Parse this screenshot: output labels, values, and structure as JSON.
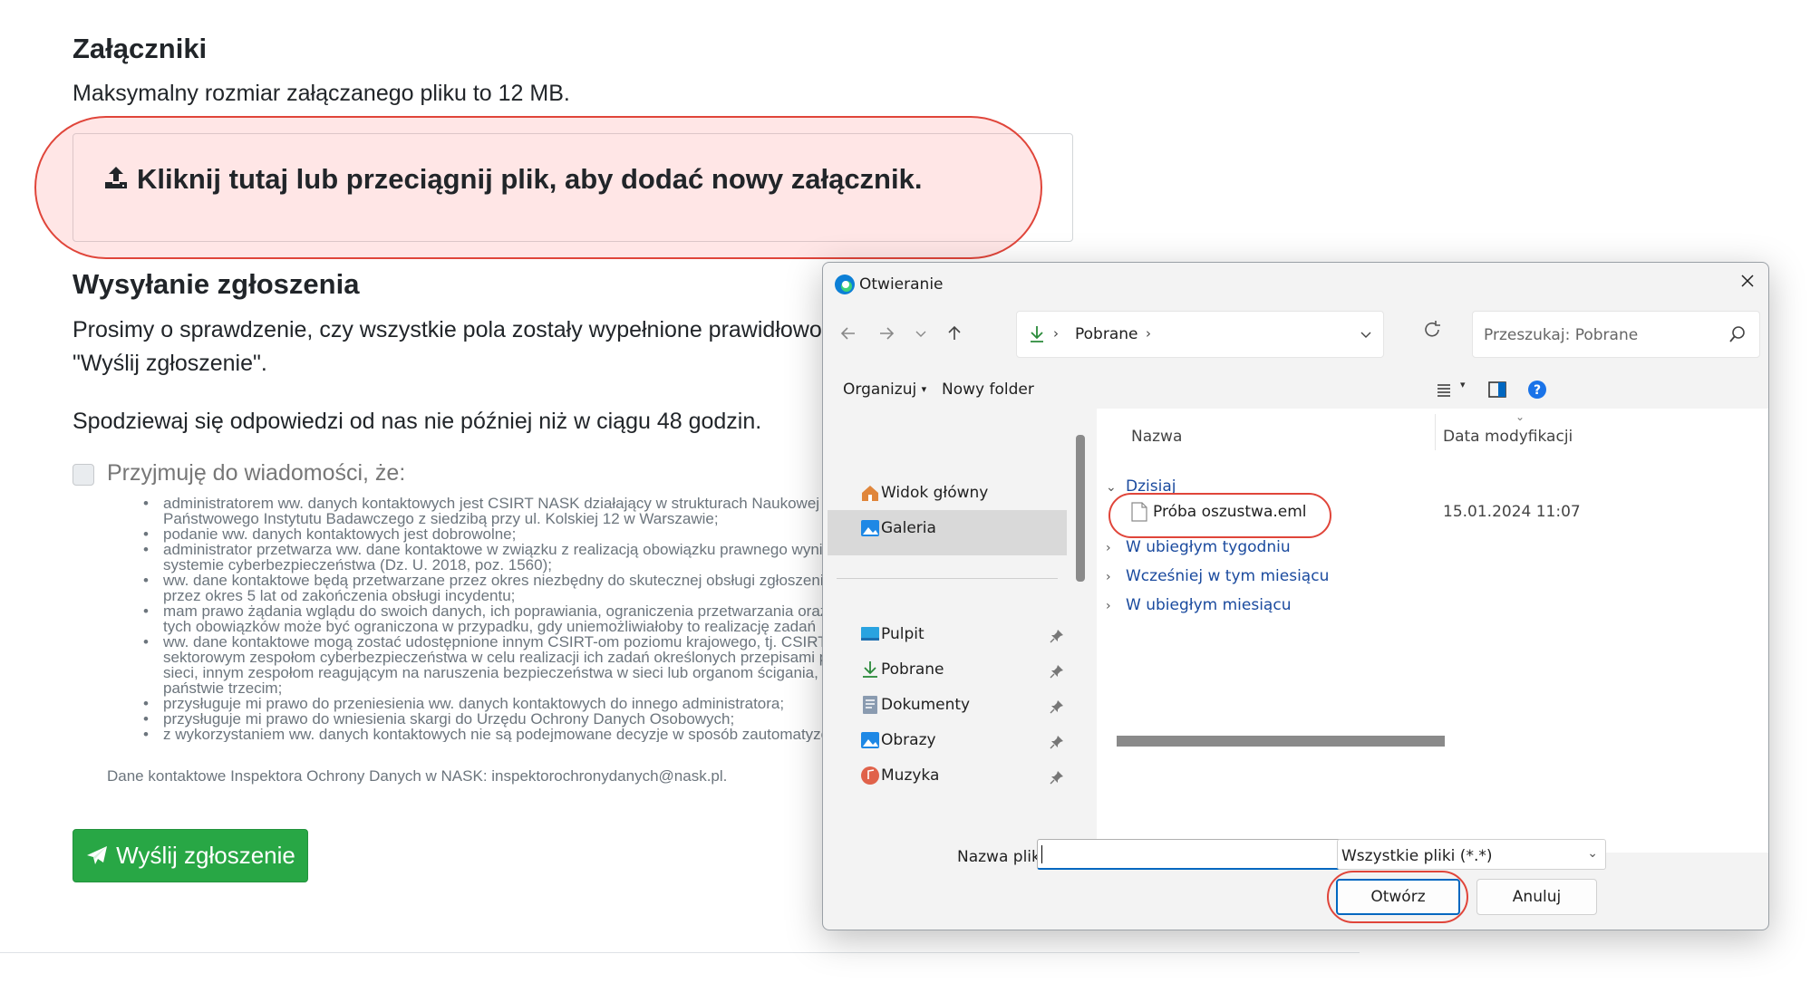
{
  "attachments": {
    "heading": "Załączniki",
    "max_size_text": "Maksymalny rozmiar załączanego pliku to 12 MB.",
    "dropzone_label": "Kliknij tutaj lub przeciągnij plik, aby dodać nowy załącznik."
  },
  "submission": {
    "heading": "Wysyłanie zgłoszenia",
    "instructions_line1": "Prosimy o sprawdzenie, czy wszystkie pola zostały wypełnione prawidłowo i",
    "instructions_line2": "\"Wyślij zgłoszenie\".",
    "response_time": "Spodziewaj się odpowiedzi od nas nie później niż w ciągu 48 godzin.",
    "consent_label": "Przyjmuję do wiadomości, że:",
    "consent_items": [
      "administratorem ww. danych kontaktowych jest CSIRT NASK działający w strukturach Naukowej i Akademickiej Sieci Komputerowej –",
      "Państwowego Instytutu Badawczego z siedzibą przy ul. Kolskiej 12 w Warszawie;",
      "podanie ww. danych kontaktowych jest dobrowolne;",
      "administrator przetwarza ww. dane kontaktowe w związku z realizacją obowiązku prawnego wynikającego z ustawy o krajowym",
      "systemie cyberbezpieczeństwa (Dz. U. 2018, poz. 1560);",
      "ww. dane kontaktowe będą przetwarzane przez okres niezbędny do skutecznej obsługi zgłoszenia,",
      "przez okres 5 lat od zakończenia obsługi incydentu;",
      "mam prawo żądania wglądu do swoich danych, ich poprawiania, ograniczenia przetwarzania oraz",
      "tych obowiązków może być ograniczona w przypadku, gdy uniemożliwiałoby to realizację zadań",
      "ww. dane kontaktowe mogą zostać udostępnione innym CSIRT-om poziomu krajowego, tj. CSIRT",
      "sektorowym zespołom cyberbezpieczeństwa w celu realizacji ich zadań określonych przepisami prawa,",
      "sieci, innym zespołom reagującym na naruszenia bezpieczeństwa w sieci lub organom ścigania, w",
      "państwie trzecim;",
      "przysługuje mi prawo do przeniesienia ww. danych kontaktowych do innego administratora;",
      "przysługuje mi prawo do wniesienia skargi do Urzędu Ochrony Danych Osobowych;",
      "z wykorzystaniem ww. danych kontaktowych nie są podejmowane decyzje w sposób zautomatyzowany."
    ],
    "iod_note": "Dane kontaktowe Inspektora Ochrony Danych w NASK: inspektorochronydanych@nask.pl.",
    "send_button": "Wyślij zgłoszenie"
  },
  "dialog": {
    "title": "Otwieranie",
    "address_folder": "Pobrane",
    "search_placeholder": "Przeszukaj: Pobrane",
    "toolbar": {
      "organize": "Organizuj",
      "new_folder": "Nowy folder"
    },
    "nav_items": [
      {
        "label": "Widok główny",
        "icon": "home-icon"
      },
      {
        "label": "Galeria",
        "icon": "gallery-icon"
      },
      {
        "label": "Pulpit",
        "icon": "desktop-icon"
      },
      {
        "label": "Pobrane",
        "icon": "download-icon"
      },
      {
        "label": "Dokumenty",
        "icon": "documents-icon"
      },
      {
        "label": "Obrazy",
        "icon": "pictures-icon"
      },
      {
        "label": "Muzyka",
        "icon": "music-icon"
      }
    ],
    "columns": {
      "name": "Nazwa",
      "modified": "Data modyfikacji"
    },
    "groups": [
      "Dzisiaj",
      "W ubiegłym tygodniu",
      "Wcześniej w tym miesiącu",
      "W ubiegłym miesiącu"
    ],
    "file": {
      "name": "Próba oszustwa.eml",
      "modified": "15.01.2024 11:07"
    },
    "filename_label": "Nazwa pliku:",
    "filename_value": "",
    "file_type": "Wszystkie pliki (*.*)",
    "open_button": "Otwórz",
    "cancel_button": "Anuluj"
  },
  "colors": {
    "accent_green": "#28a745",
    "highlight_red": "#e0453a",
    "dialog_blue": "#0067c0",
    "link_blue": "#1a4a9e"
  }
}
